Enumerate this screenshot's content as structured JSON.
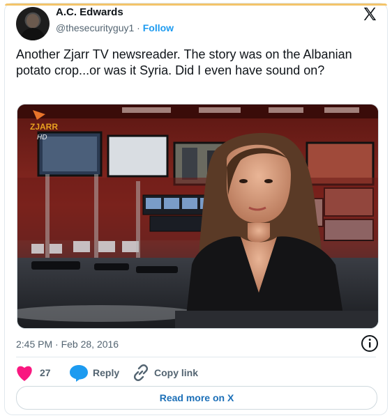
{
  "author": {
    "name": "A.C. Edwards",
    "handle": "@thesecurityguy1",
    "separator": " · ",
    "follow_label": "Follow"
  },
  "tweet": {
    "text": "Another Zjarr TV newsreader. The story was on the Albanian potato crop...or was it Syria. Did I even have sound on?",
    "timestamp": "2:45 PM · Feb 28, 2016"
  },
  "media": {
    "logo_text": "ZJARR",
    "logo_sub": "HD"
  },
  "actions": {
    "likes_count": "27",
    "reply_label": "Reply",
    "copy_link_label": "Copy link"
  },
  "footer": {
    "read_more_label": "Read more on X"
  },
  "colors": {
    "accent": "#1d9bf0",
    "like": "#f91880",
    "muted": "#536471"
  },
  "icons": [
    "x-logo-icon",
    "info-icon",
    "heart-icon",
    "reply-bubble-icon",
    "link-icon"
  ]
}
